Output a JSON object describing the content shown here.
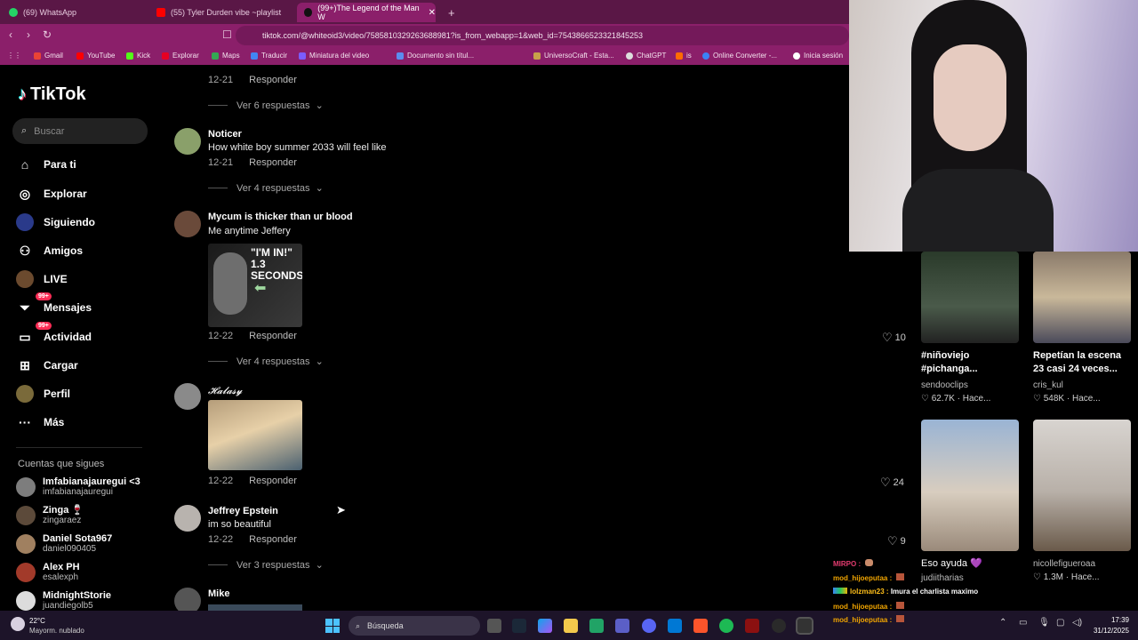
{
  "browser": {
    "tabs": [
      {
        "label": "(69) WhatsApp"
      },
      {
        "label": "(55) Tyler Durden vibe ~playlist"
      },
      {
        "label": "(99+)The Legend of the Man W"
      }
    ],
    "url": "tiktok.com/@whiteoid3/video/7585810329263688981?is_from_webapp=1&web_id=7543866523321845253",
    "bookmarks": [
      "Gmail",
      "YouTube",
      "Kick",
      "Explorar",
      "Maps",
      "Traducir",
      "Miniatura del video",
      "Documento sin títul...",
      "UniversoCraft - Esta...",
      "ChatGPT",
      "is",
      "Online Converter -...",
      "Inicia sesión"
    ]
  },
  "sidebar": {
    "logo": "TikTok",
    "search_placeholder": "Buscar",
    "nav": [
      {
        "label": "Para ti"
      },
      {
        "label": "Explorar"
      },
      {
        "label": "Siguiendo"
      },
      {
        "label": "Amigos"
      },
      {
        "label": "LIVE"
      },
      {
        "label": "Mensajes",
        "badge": "99+"
      },
      {
        "label": "Actividad",
        "badge": "99+"
      },
      {
        "label": "Cargar"
      },
      {
        "label": "Perfil"
      },
      {
        "label": "Más"
      }
    ],
    "following_title": "Cuentas que sigues",
    "following": [
      {
        "name": "Imfabianajauregui <3",
        "handle": "imfabianajauregui"
      },
      {
        "name": "Zinga 🍷",
        "handle": "zingaraez"
      },
      {
        "name": "Daniel Sota967",
        "handle": "daniel090405"
      },
      {
        "name": "Alex PH",
        "handle": "esalexph"
      },
      {
        "name": "MidnightStorie",
        "handle": "juandiegolb5"
      }
    ]
  },
  "comments": {
    "reply_label": "Responder",
    "items": [
      {
        "name": "",
        "text": "",
        "date": "12-21",
        "replies": "Ver 6 respuestas"
      },
      {
        "name": "Noticer",
        "text": "How white boy summer 2033 will feel like",
        "date": "12-21",
        "replies": "Ver 4 respuestas"
      },
      {
        "name": "Mycum is thicker than ur blood",
        "text": "Me anytime Jeffery",
        "date": "12-22",
        "replies": "Ver 4 respuestas",
        "likes": "10",
        "image_text": "\"I'M IN!\" 1.3 SECONDS"
      },
      {
        "name": "𝓗𝓪𝓵𝓪𝓼𝔂",
        "text": "",
        "date": "12-22",
        "likes": "24"
      },
      {
        "name": "Jeffrey Epstein",
        "text": "im so beautiful",
        "date": "12-22",
        "replies": "Ver 3 respuestas",
        "likes": "9"
      },
      {
        "name": "Mike",
        "text": ""
      }
    ]
  },
  "recommended": [
    {
      "title": "#niñoviejo #pichanga...",
      "author": "sendooclips",
      "meta": "♡ 62.7K · Hace..."
    },
    {
      "title": "Repetían la escena 23 casi 24 veces...",
      "author": "cris_kul",
      "meta": "♡ 548K · Hace..."
    },
    {
      "title": "Eso ayuda 💜",
      "author": "judiitharias",
      "meta": ""
    },
    {
      "title": "",
      "author": "nicollefigueroaa",
      "meta": "♡ 1.3M · Hace..."
    }
  ],
  "chat": [
    {
      "user": "MIRPO :",
      "msg": "",
      "color": "#e33b6f"
    },
    {
      "user": "mod_hijoeputaa :",
      "msg": "",
      "color": "#f0a400"
    },
    {
      "user": "lolzman23 :",
      "msg": "Imura el charlista maximo",
      "color": "#ffbf1a"
    },
    {
      "user": "mod_hijoeputaa :",
      "msg": "",
      "color": "#f0a400"
    },
    {
      "user": "mod_hijoeputaa :",
      "msg": "",
      "color": "#f0a400"
    }
  ],
  "taskbar": {
    "temp": "22°C",
    "weather": "Mayorm. nublado",
    "search": "Búsqueda",
    "time": "17:39",
    "date": "31/12/2025"
  },
  "colors": {
    "accent": "#fe2c55",
    "chrome": "#8b1f6a"
  }
}
